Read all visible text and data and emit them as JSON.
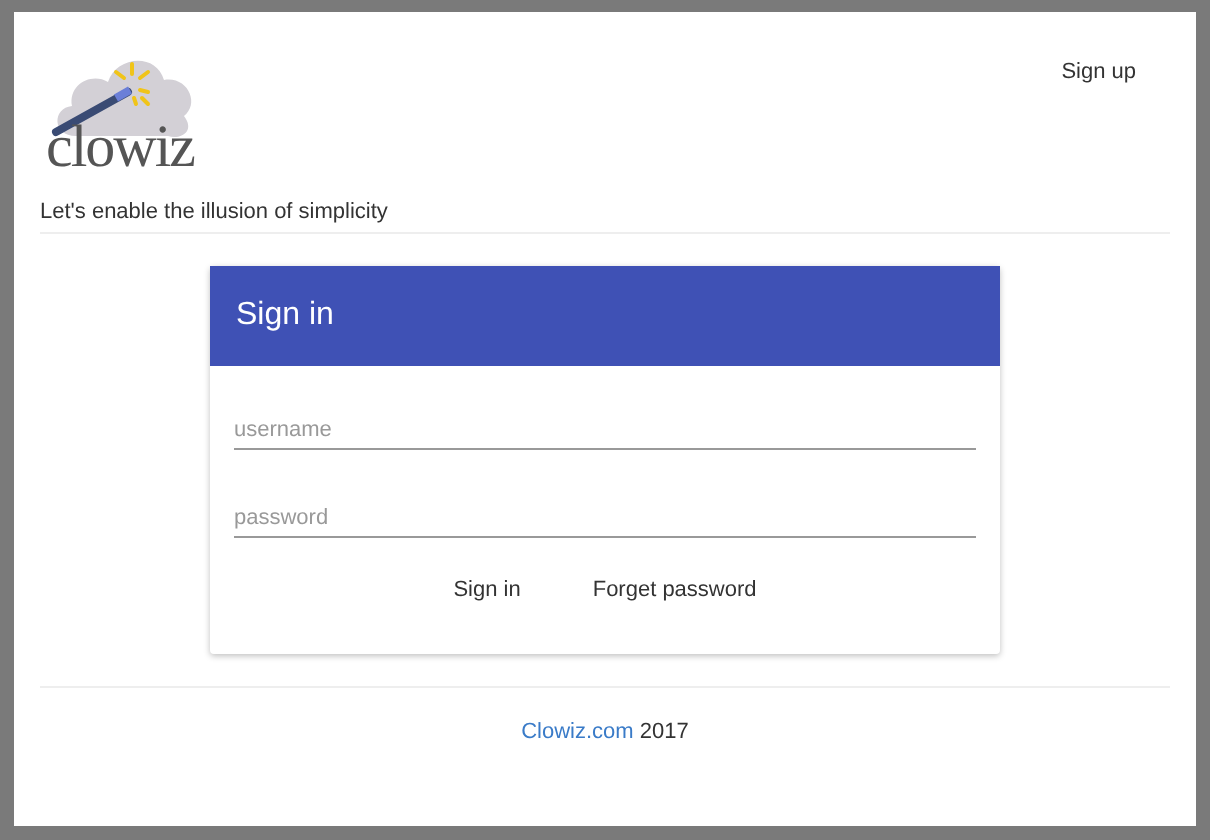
{
  "header": {
    "logo_text": "clowiz",
    "tagline": "Let's enable the illusion of simplicity",
    "signup_link": "Sign up"
  },
  "card": {
    "title": "Sign in",
    "fields": [
      {
        "placeholder": "username"
      },
      {
        "placeholder": "password"
      }
    ],
    "actions": [
      "Sign in",
      "Forget password"
    ]
  },
  "footer": {
    "link": "Clowiz.com",
    "year": "2017"
  }
}
